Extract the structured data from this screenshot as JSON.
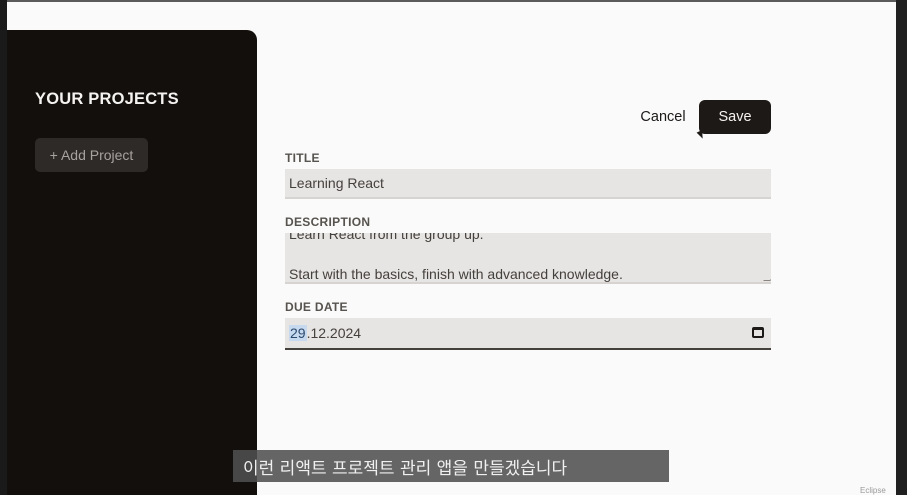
{
  "sidebar": {
    "title": "YOUR PROJECTS",
    "add_project_label": "+ Add Project"
  },
  "form": {
    "cancel_label": "Cancel",
    "save_label": "Save",
    "title_label": "TITLE",
    "title_value": "Learning React",
    "description_label": "DESCRIPTION",
    "description_line1": "Learn React from the group up.",
    "description_line2": "Start with the basics, finish with advanced knowledge.",
    "due_date_label": "DUE DATE",
    "due_date_day": "29",
    "due_date_rest": ".12.2024"
  },
  "subtitle": "이런 리액트 프로젝트 관리 앱을 만들겠습니다",
  "watermark": "Eclipse",
  "icons": [
    "calendar-icon",
    "mouse-cursor-icon"
  ]
}
